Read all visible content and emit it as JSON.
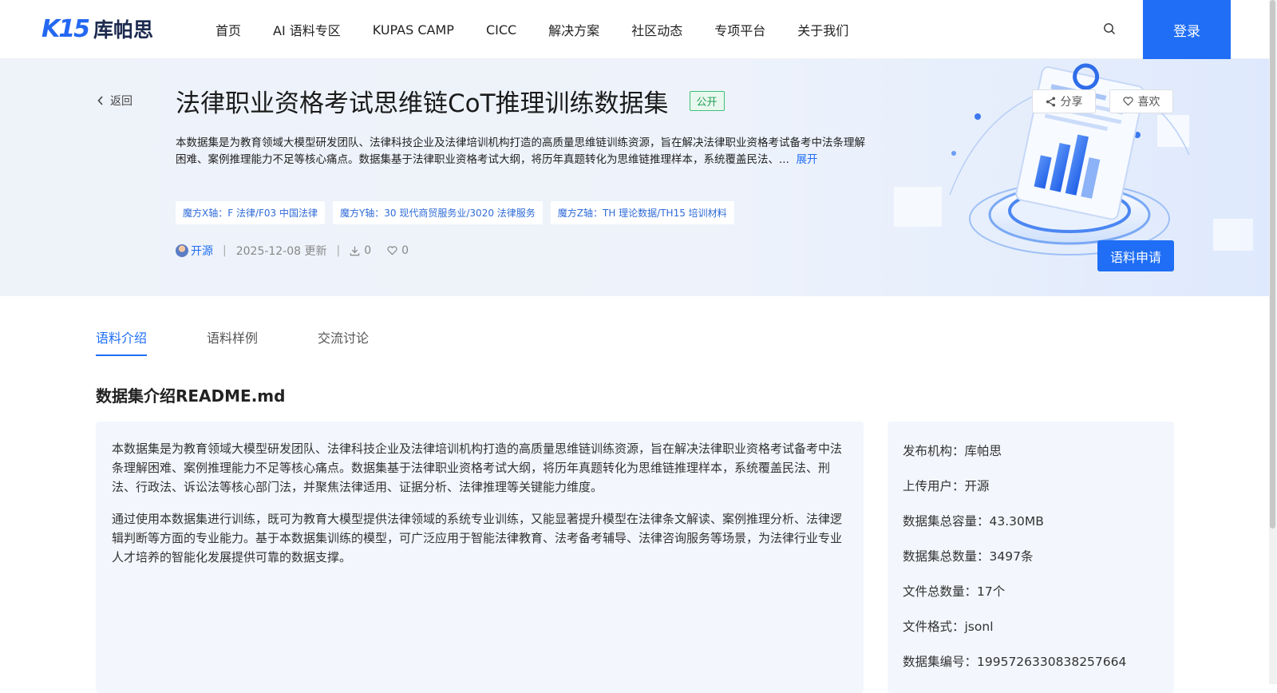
{
  "header": {
    "logo_mark": "K15",
    "logo_text": "库帕思",
    "nav": [
      "首页",
      "AI 语料专区",
      "KUPAS CAMP",
      "CICC",
      "解决方案",
      "社区动态",
      "专项平台",
      "关于我们"
    ],
    "login_label": "登录"
  },
  "banner": {
    "back_label": "返回",
    "title": "法律职业资格考试思维链CoT推理训练数据集",
    "badge": "公开",
    "share_label": "分享",
    "like_label": "喜欢",
    "description": "本数据集是为教育领域大模型研发团队、法律科技企业及法律培训机构打造的高质量思维链训练资源，旨在解决法律职业资格考试备考中法条理解困难、案例推理能力不足等核心痛点。数据集基于法律职业资格考试大纲，将历年真题转化为思维链推理样本，系统覆盖民法、...",
    "expand_label": "展开",
    "tags": [
      "魔方X轴：F 法律/F03 中国法律",
      "魔方Y轴：30 现代商贸服务业/3020 法律服务",
      "魔方Z轴：TH 理论数据/TH15 培训材料"
    ],
    "author": "开源",
    "updated": "2025-12-08 更新",
    "downloads": "0",
    "likes": "0",
    "apply_label": "语料申请"
  },
  "tabs": [
    "语料介绍",
    "语料样例",
    "交流讨论"
  ],
  "section_title": "数据集介绍README.md",
  "readme": {
    "p1": "本数据集是为教育领域大模型研发团队、法律科技企业及法律培训机构打造的高质量思维链训练资源，旨在解决法律职业资格考试备考中法条理解困难、案例推理能力不足等核心痛点。数据集基于法律职业资格考试大纲，将历年真题转化为思维链推理样本，系统覆盖民法、刑法、行政法、诉讼法等核心部门法，并聚焦法律适用、证据分析、法律推理等关键能力维度。",
    "p2": "通过使用本数据集进行训练，既可为教育大模型提供法律领域的系统专业训练，又能显著提升模型在法律条文解读、案例推理分析、法律逻辑判断等方面的专业能力。基于本数据集训练的模型，可广泛应用于智能法律教育、法考备考辅导、法律咨询服务等场景，为法律行业专业人才培养的智能化发展提供可靠的数据支撑。"
  },
  "info": [
    "发布机构：库帕思",
    "上传用户：开源",
    "数据集总容量：43.30MB",
    "数据集总数量：3497条",
    "文件总数量：17个",
    "文件格式：jsonl",
    "数据集编号：1995726330838257664"
  ],
  "colors": {
    "accent": "#1f6ef5",
    "badge_green": "#1f9d55"
  }
}
